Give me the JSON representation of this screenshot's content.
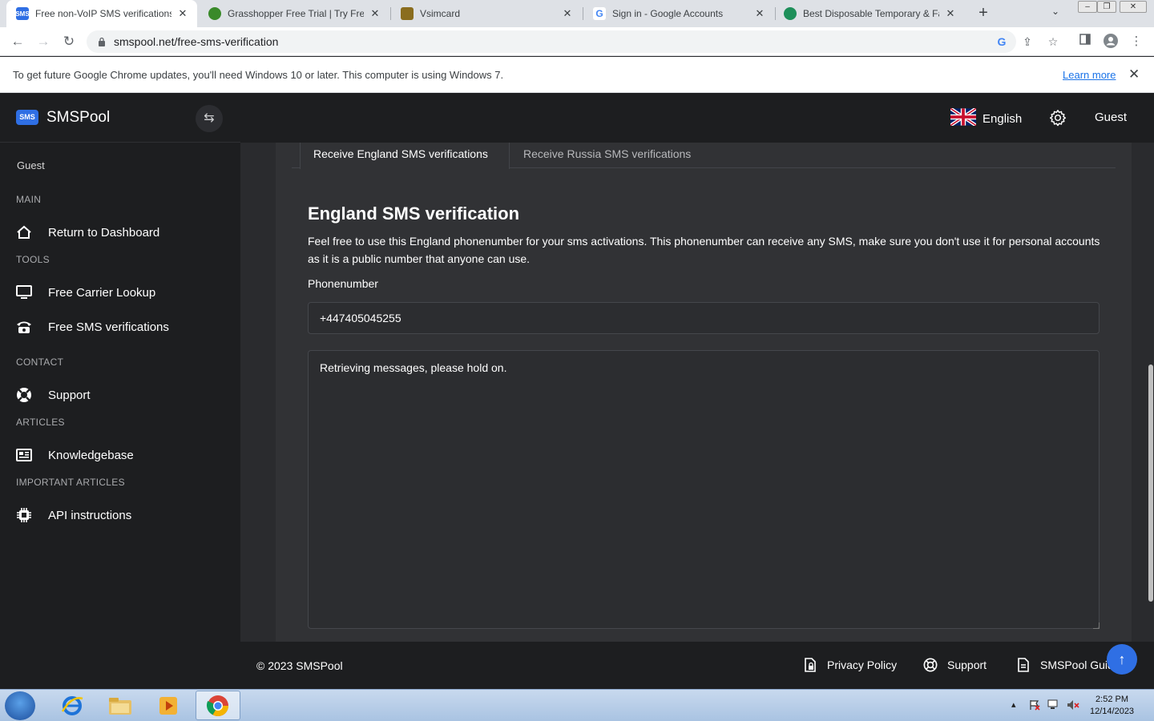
{
  "browser": {
    "tabs": [
      {
        "title": "Free non-VoIP SMS verifications",
        "active": true
      },
      {
        "title": "Grasshopper Free Trial | Try Free",
        "active": false
      },
      {
        "title": "Vsimcard",
        "active": false
      },
      {
        "title": "Sign in - Google Accounts",
        "active": false
      },
      {
        "title": "Best Disposable Temporary & Fa",
        "active": false
      }
    ],
    "url": "smspool.net/free-sms-verification",
    "infobar_message": "To get future Google Chrome updates, you'll need Windows 10 or later. This computer is using Windows 7.",
    "infobar_link": "Learn more"
  },
  "sidebar": {
    "brand_logo": "SMS",
    "brand_name": "SMSPool",
    "user": "Guest",
    "sections": {
      "main": "MAIN",
      "tools": "TOOLS",
      "contact": "CONTACT",
      "articles": "ARTICLES",
      "important": "IMPORTANT ARTICLES"
    },
    "items": {
      "dashboard": "Return to Dashboard",
      "carrier": "Free Carrier Lookup",
      "sms": "Free SMS verifications",
      "support": "Support",
      "knowledge": "Knowledgebase",
      "api": "API instructions"
    }
  },
  "topnav": {
    "language": "English",
    "user": "Guest"
  },
  "main": {
    "tabs": {
      "active": "Receive England SMS verifications",
      "inactive": "Receive Russia SMS verifications"
    },
    "heading": "England SMS verification",
    "description": "Feel free to use this England phonenumber for your sms activations. This phonenumber can receive any SMS, make sure you don't use it for personal accounts as it is a public number that anyone can use.",
    "phone_label": "Phonenumber",
    "phone_value": "+447405045255",
    "messages_text": "Retrieving messages, please hold on."
  },
  "footer": {
    "copyright": "© 2023 SMSPool",
    "privacy": "Privacy Policy",
    "support": "Support",
    "guide": "SMSPool Guide"
  },
  "taskbar": {
    "time": "2:52 PM",
    "date": "12/14/2023"
  },
  "colors": {
    "accent": "#2f6fe4",
    "sidebar_bg": "#1d1e20",
    "content_bg": "#2a2b2e",
    "card_bg": "#313235"
  }
}
